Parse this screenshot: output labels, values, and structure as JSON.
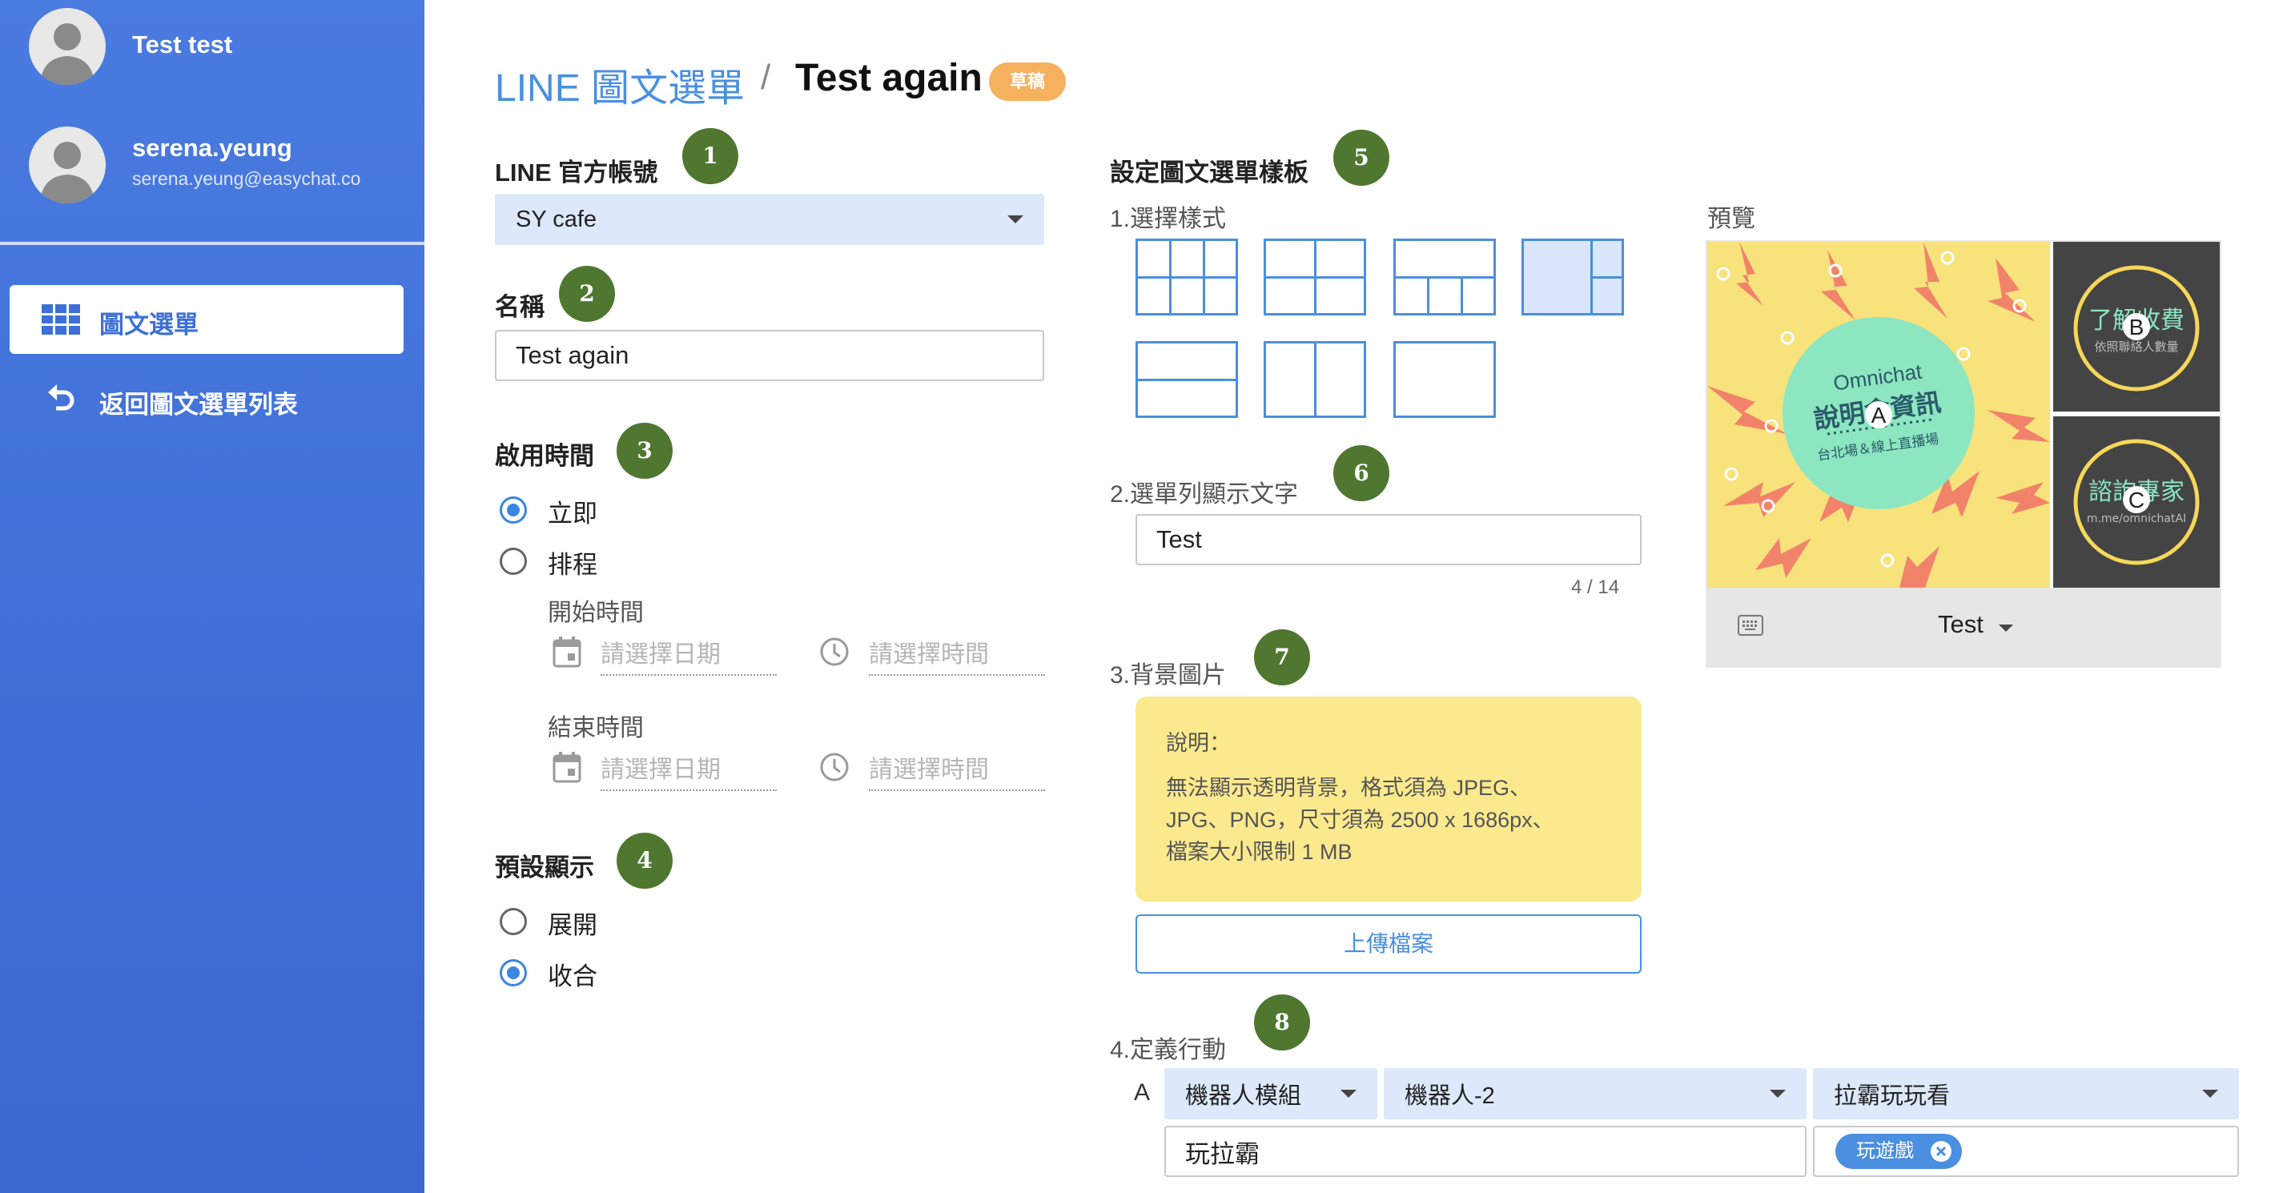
{
  "users": [
    {
      "name": "Test test"
    },
    {
      "name": "serena.yeung",
      "email": "serena.yeung@easychat.co"
    }
  ],
  "nav": {
    "active": "圖文選單",
    "back": "返回圖文選單列表"
  },
  "breadcrumb": {
    "parent": "LINE 圖文選單",
    "separator": "/",
    "current": "Test again",
    "badge": "草稿"
  },
  "steps": [
    "1",
    "2",
    "3",
    "4",
    "5",
    "6",
    "7",
    "8"
  ],
  "form": {
    "account_label": "LINE 官方帳號",
    "account_value": "SY cafe",
    "name_label": "名稱",
    "name_value": "Test again",
    "enable_label": "啟用時間",
    "enable_options": [
      "立即",
      "排程"
    ],
    "enable_selected": "立即",
    "start_label": "開始時間",
    "end_label": "結束時間",
    "date_placeholder": "請選擇日期",
    "time_placeholder": "請選擇時間",
    "default_label": "預設顯示",
    "default_options": [
      "展開",
      "收合"
    ],
    "default_selected": "收合"
  },
  "template": {
    "title": "設定圖文選單樣板",
    "style_label": "1.選擇樣式",
    "bar_label": "2.選單列顯示文字",
    "bar_value": "Test",
    "bar_counter": "4 / 14",
    "bg_label": "3.背景圖片",
    "note_title": "說明：",
    "note_lines": [
      "無法顯示透明背景，格式須為 JPEG、",
      "JPG、PNG，尺寸須為 2500 x 1686px、",
      "檔案大小限制 1 MB"
    ],
    "upload_label": "上傳檔案",
    "action_label": "4.定義行動",
    "action_row": {
      "key": "A",
      "type": "機器人模組",
      "bot": "機器人-2",
      "module": "拉霸玩玩看",
      "text": "玩拉霸",
      "tag": "玩遊戲"
    }
  },
  "preview": {
    "label": "預覽",
    "bar_text": "Test",
    "area_labels": [
      "A",
      "B",
      "C"
    ],
    "main": {
      "brand": "Omnichat",
      "title": "說明會資訊",
      "subtitle": "台北場＆線上直播場"
    },
    "side_top": {
      "title": "了解收費",
      "subtitle": "依照聯絡人數量"
    },
    "side_bottom": {
      "title": "諮詢專家",
      "subtitle": "m.me/omnichatAI"
    }
  },
  "colors": {
    "sidebar": "#4a7be0",
    "accent": "#4a8fe0",
    "step": "#4f7730",
    "badge": "#f5b15d",
    "note": "#fbe98e",
    "preview_yellow": "#f8e27c",
    "preview_green": "#8ce6c0",
    "preview_dark": "#444444"
  },
  "icons": [
    "person-avatar-icon",
    "grid-icon",
    "return-icon",
    "dropdown-arrow-icon",
    "calendar-icon",
    "clock-icon",
    "close-circle-icon",
    "keyboard-icon"
  ]
}
